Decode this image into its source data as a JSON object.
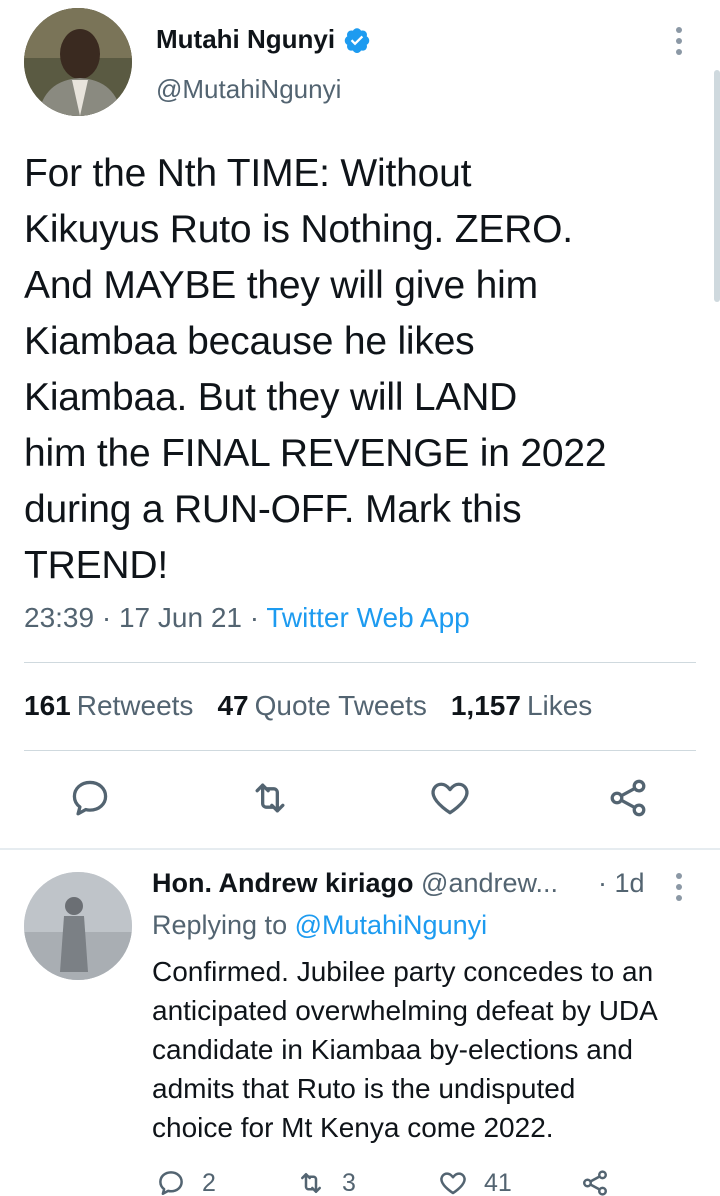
{
  "tweet": {
    "author_name": "Mutahi Ngunyi",
    "author_handle": "@MutahiNgunyi",
    "verified": true,
    "text": "For the Nth TIME: Without\nKikuyus Ruto is Nothing. ZERO.\nAnd MAYBE they will give him\nKiambaa because he likes\nKiambaa. But they will LAND\nhim the FINAL REVENGE in 2022\nduring a RUN-OFF. Mark this\nTREND!",
    "time": "23:39",
    "date": "17 Jun 21",
    "app": "Twitter Web App",
    "stats": {
      "retweets_count": "161",
      "retweets_label": "Retweets",
      "quotes_count": "47",
      "quotes_label": "Quote Tweets",
      "likes_count": "1,157",
      "likes_label": "Likes"
    }
  },
  "icons": {
    "reply": "reply-icon",
    "retweet": "retweet-icon",
    "like": "heart-icon",
    "share": "share-icon",
    "more": "more-vertical-icon",
    "verified": "verified-badge-icon"
  },
  "colors": {
    "accent": "#1d9bf0",
    "text": "#0f1419",
    "secondary": "#536471"
  },
  "reply": {
    "author_name": "Hon. Andrew kiriago",
    "author_handle": "@andrew...",
    "time": "1d",
    "replying_label": "Replying to",
    "replying_to": "@MutahiNgunyi",
    "text": "Confirmed. Jubilee party concedes to an\nanticipated overwhelming defeat by UDA\ncandidate in Kiambaa by-elections and\nadmits that Ruto is the undisputed\nchoice for Mt Kenya come 2022.",
    "reply_count": "2",
    "retweet_count": "3",
    "like_count": "41"
  }
}
